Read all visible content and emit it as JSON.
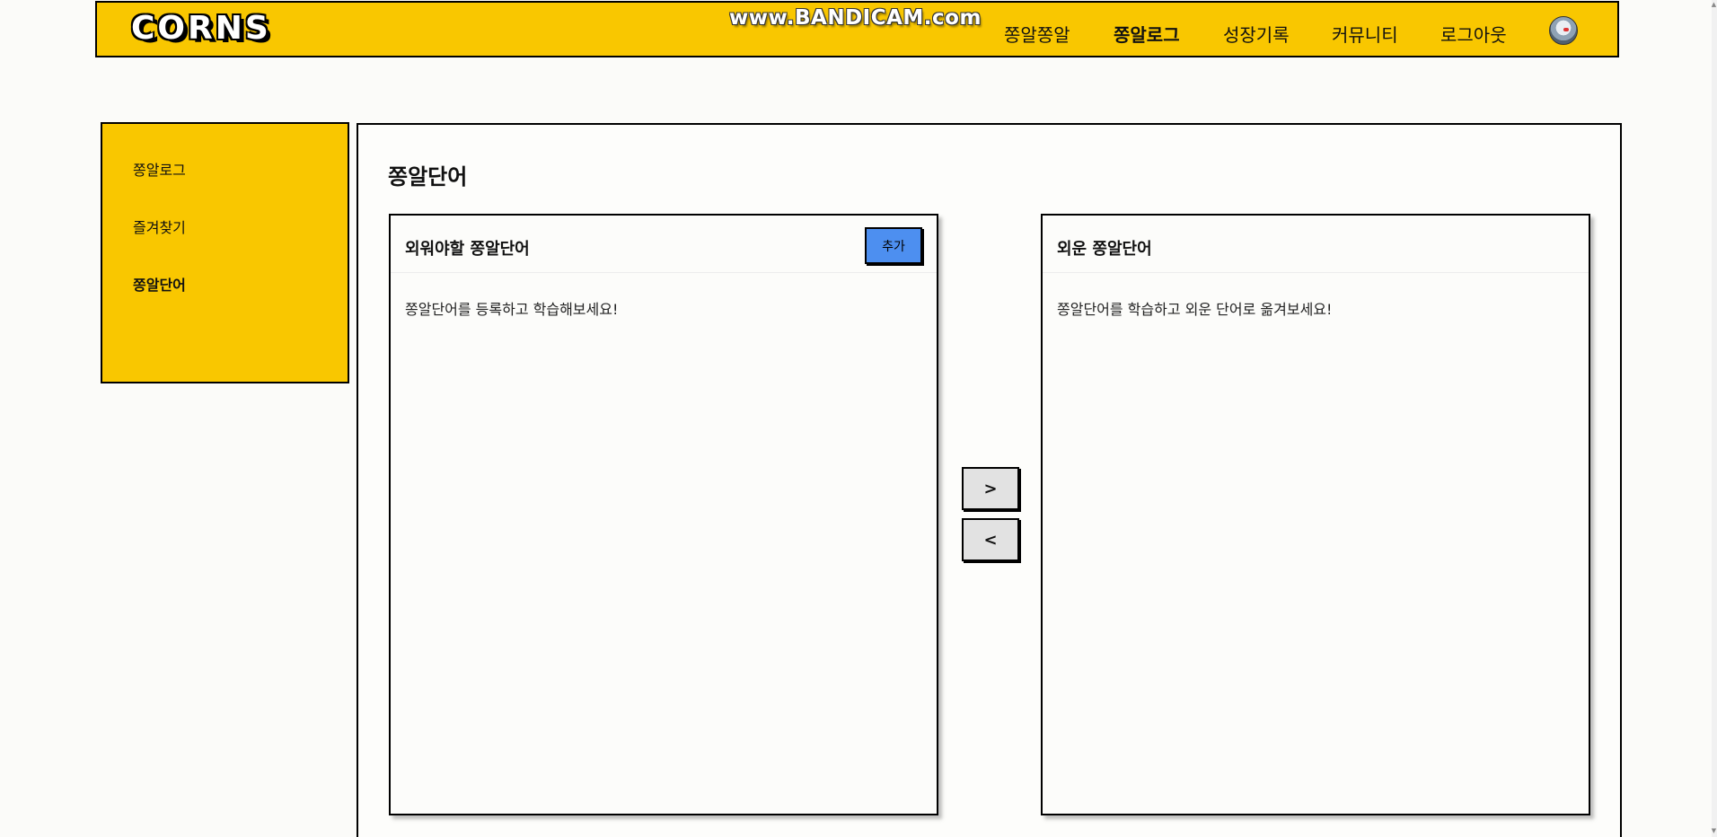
{
  "header": {
    "logo": "CORNS",
    "watermark": "www.BANDICAM.com",
    "nav": [
      {
        "label": "쫑알쫑알",
        "active": false
      },
      {
        "label": "쫑알로그",
        "active": true
      },
      {
        "label": "성장기록",
        "active": false
      },
      {
        "label": "커뮤니티",
        "active": false
      },
      {
        "label": "로그아웃",
        "active": false
      }
    ],
    "avatar_icon": "user-avatar-icon"
  },
  "sidebar": {
    "items": [
      {
        "label": "쫑알로그",
        "active": false
      },
      {
        "label": "즐겨찾기",
        "active": false
      },
      {
        "label": "쫑알단어",
        "active": true
      }
    ]
  },
  "main": {
    "title": "쫑알단어",
    "left_box": {
      "title": "외워야할 쫑알단어",
      "add_label": "추가",
      "empty_text": "쫑알단어를 등록하고 학습해보세요!"
    },
    "right_box": {
      "title": "외운 쫑알단어",
      "empty_text": "쫑알단어를 학습하고 외운 단어로 옮겨보세요!"
    },
    "move_right_label": ">",
    "move_left_label": "<"
  },
  "colors": {
    "brand_yellow": "#f9c700",
    "add_button_blue": "#4d8ff0",
    "move_button_gray": "#e2e2e2",
    "border": "#000000"
  }
}
